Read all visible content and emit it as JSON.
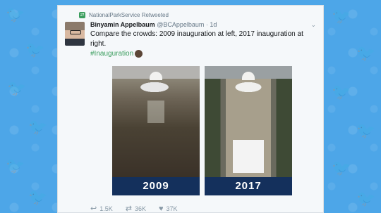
{
  "tweet": {
    "retweeted_by": "NationalParkService Retweeted",
    "author_name": "Binyamin Appelbaum",
    "author_handle": "@BCAppelbaum",
    "time": "· 1d",
    "text": "Compare the crowds: 2009 inauguration at left, 2017 inauguration at right.",
    "hashtag": "#Inauguration"
  },
  "photos": [
    {
      "year": "2009"
    },
    {
      "year": "2017"
    }
  ],
  "actions": {
    "reply_count": "1.5K",
    "retweet_count": "36K",
    "like_count": "37K"
  },
  "icons": {
    "background": "twitter-bird-icon",
    "retweet_badge": "retweet-icon",
    "menu": "chevron-down-icon",
    "reply": "reply-icon",
    "retweet": "retweet-icon",
    "like": "heart-icon"
  },
  "colors": {
    "background": "#4da6e8",
    "year_bar": "#14305c",
    "hashtag": "#3a9d5d"
  }
}
